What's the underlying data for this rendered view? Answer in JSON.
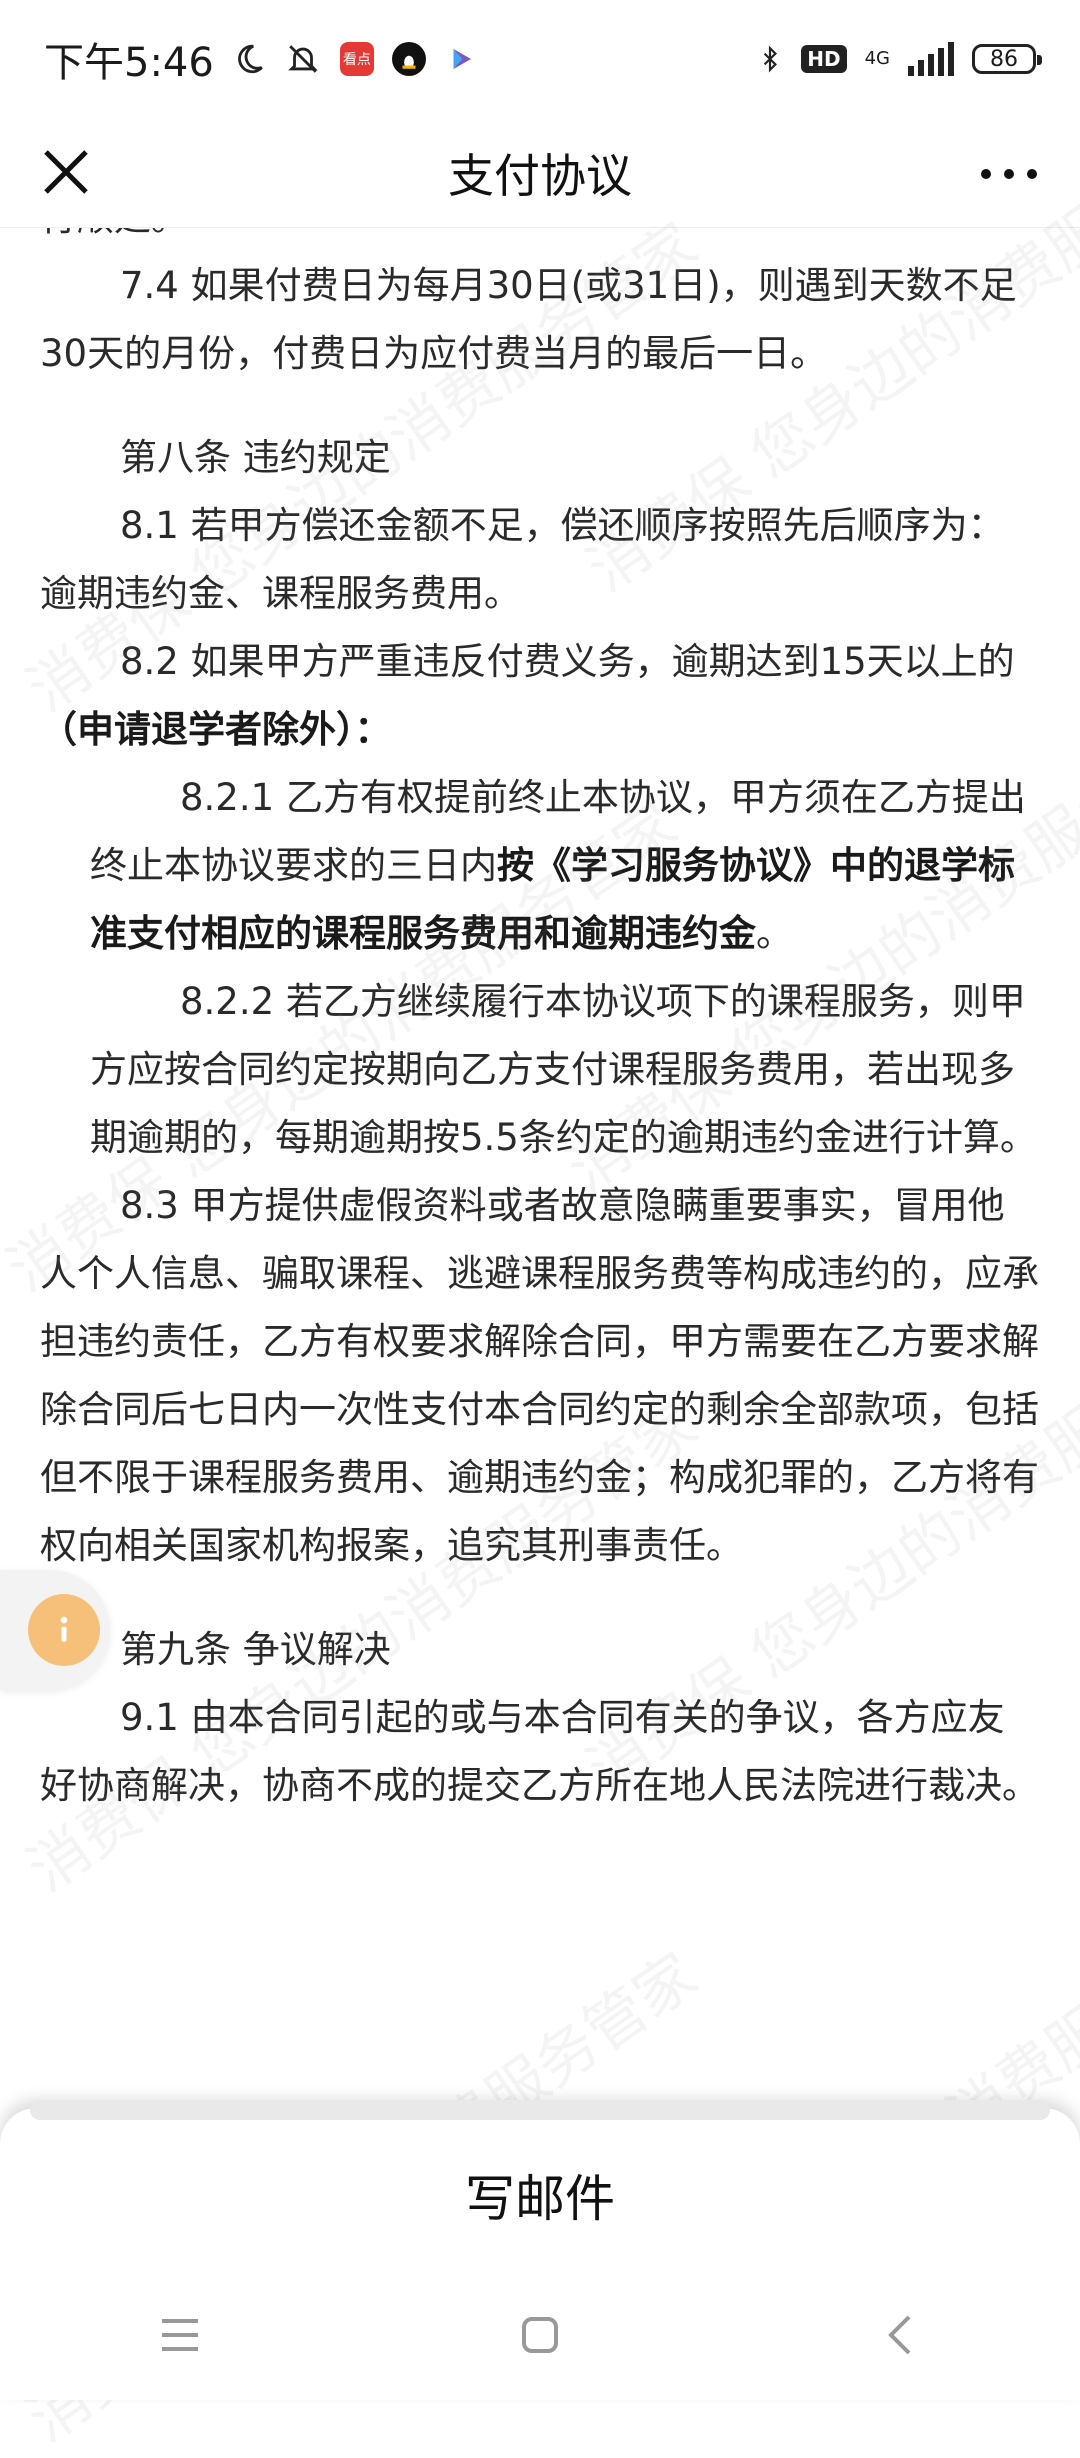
{
  "status_bar": {
    "time": "下午5:46",
    "net_type": "4G",
    "hd": "HD",
    "battery": "86",
    "app_badge": "看点"
  },
  "nav": {
    "title": "支付协议"
  },
  "document": {
    "cut_line": "行顺延。",
    "p74": "7.4 如果付费日为每月30日(或31日)，则遇到天数不足30天的月份，付费日为应付费当月的最后一日。",
    "h8": "第八条 违约规定",
    "p81": "8.1 若甲方偿还金额不足，偿还顺序按照先后顺序为：逾期违约金、课程服务费用。",
    "p82_a": "8.2 如果甲方严重违反付费义务，逾期达到15天以上的",
    "p82_b": "（申请退学者除外）",
    "p82_c": "：",
    "p821_a": "8.2.1 乙方有权提前终止本协议，甲方须在乙方提出终止本协议要求的三日内",
    "p821_b": "按《学习服务协议》中的退学标准支付相应的课程服务费用和逾期违约金",
    "p821_c": "。",
    "p822": "8.2.2 若乙方继续履行本协议项下的课程服务，则甲方应按合同约定按期向乙方支付课程服务费用，若出现多期逾期的，每期逾期按5.5条约定的逾期违约金进行计算。",
    "p83": "8.3 甲方提供虚假资料或者故意隐瞒重要事实，冒用他人个人信息、骗取课程、逃避课程服务费等构成违约的，应承担违约责任，乙方有权要求解除合同，甲方需要在乙方要求解除合同后七日内一次性支付本合同约定的剩余全部款项，包括但不限于课程服务费用、逾期违约金；构成犯罪的，乙方将有权向相关国家机构报案，追究其刑事责任。",
    "h9": "第九条 争议解决",
    "p91": "9.1 由本合同引起的或与本合同有关的争议，各方应友好协商解决，协商不成的提交乙方所在地人民法院进行裁决。"
  },
  "watermark": {
    "text": "消费保 您身边的消费服务管家"
  },
  "bottom_sheet": {
    "compose_label": "写邮件"
  }
}
